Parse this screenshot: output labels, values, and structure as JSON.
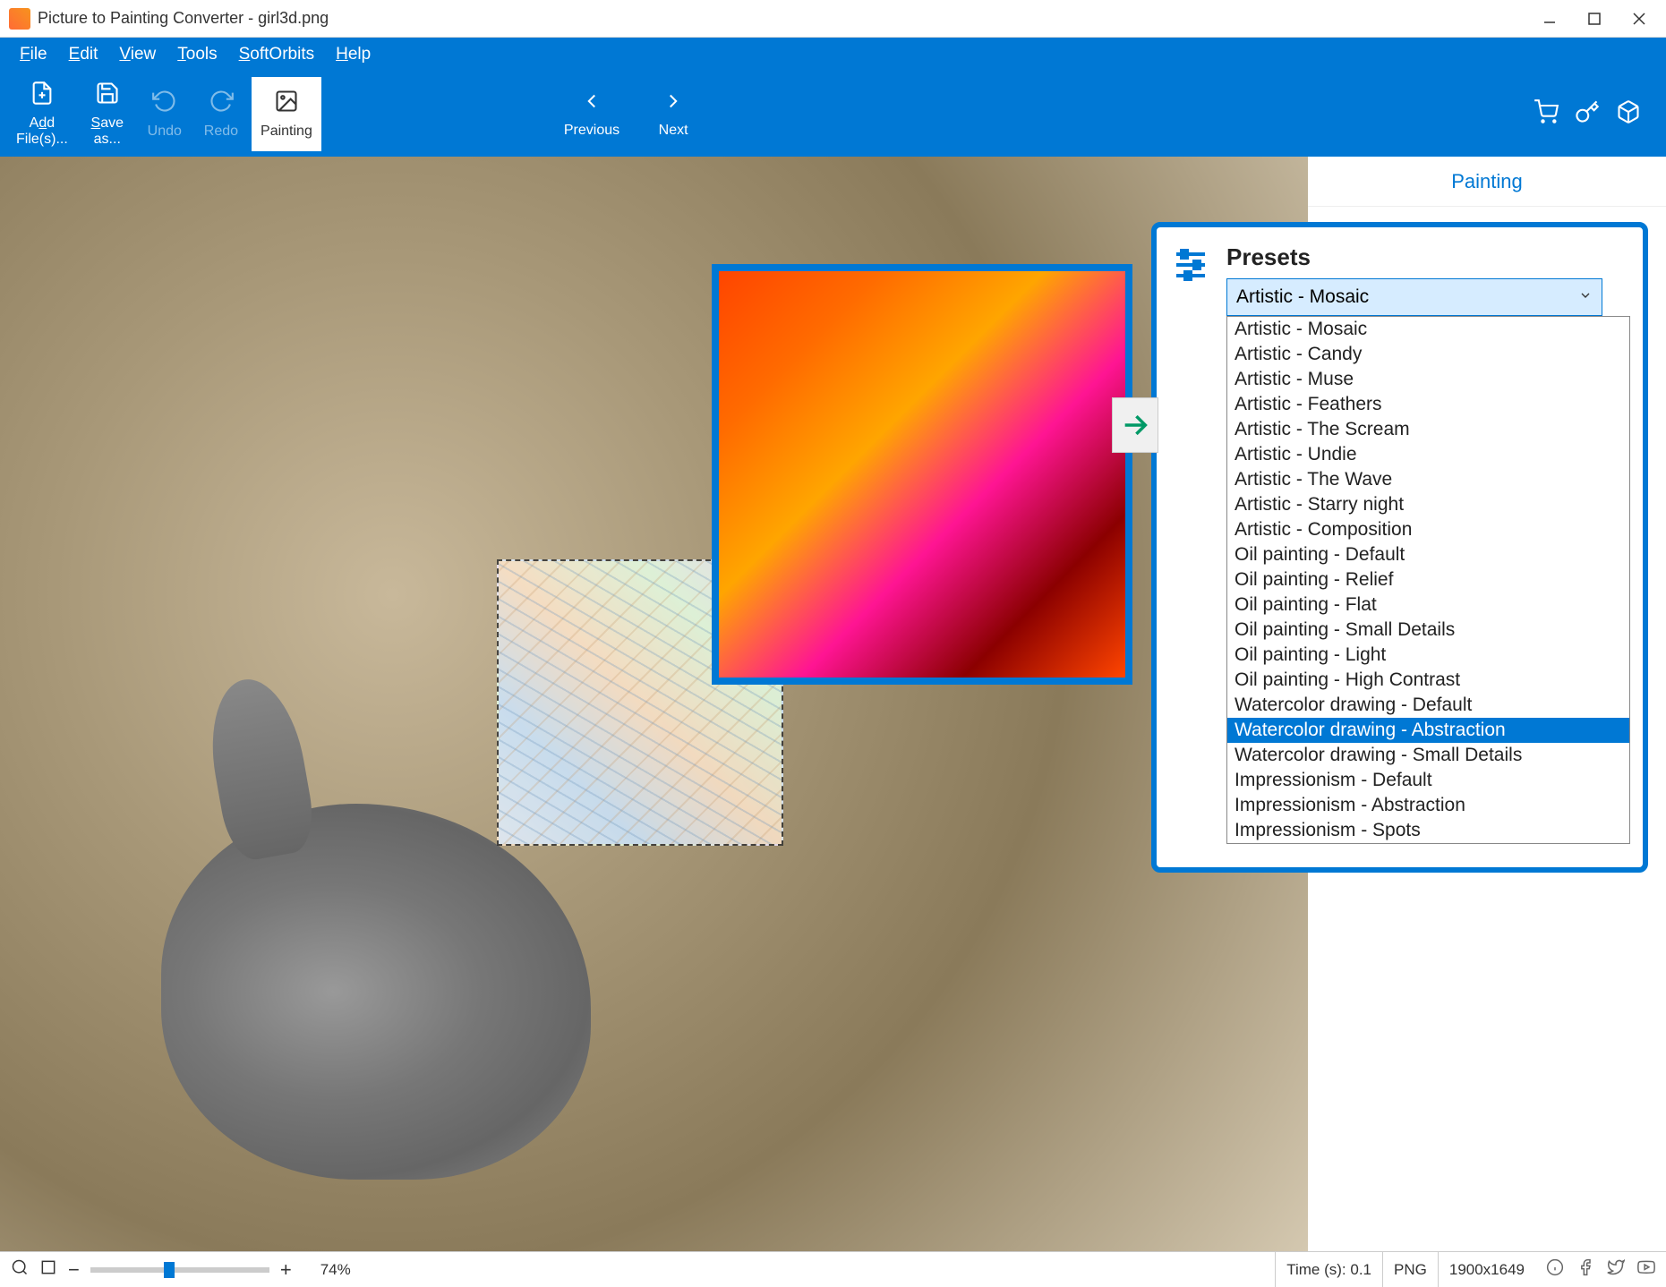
{
  "window": {
    "title": "Picture to Painting Converter - girl3d.png"
  },
  "menu": {
    "file": "File",
    "edit": "Edit",
    "view": "View",
    "tools": "Tools",
    "softorbits": "SoftOrbits",
    "help": "Help"
  },
  "toolbar": {
    "add_files": "Add\nFile(s)...",
    "save_as": "Save\nas...",
    "undo": "Undo",
    "redo": "Redo",
    "painting": "Painting",
    "previous": "Previous",
    "next": "Next"
  },
  "side": {
    "tab_painting": "Painting"
  },
  "presets": {
    "title": "Presets",
    "selected": "Artistic - Mosaic",
    "options": [
      "Artistic - Mosaic",
      "Artistic - Candy",
      "Artistic - Muse",
      "Artistic - Feathers",
      "Artistic - The Scream",
      "Artistic - Undie",
      "Artistic - The Wave",
      "Artistic - Starry night",
      "Artistic - Composition",
      "Oil painting - Default",
      "Oil painting - Relief",
      "Oil painting - Flat",
      "Oil painting - Small Details",
      "Oil painting - Light",
      "Oil painting - High Contrast",
      "Watercolor drawing - Default",
      "Watercolor drawing - Abstraction",
      "Watercolor drawing - Small Details",
      "Impressionism - Default",
      "Impressionism - Abstraction",
      "Impressionism - Spots"
    ],
    "highlighted_index": 16
  },
  "status": {
    "zoom_percent": "74%",
    "time": "Time (s): 0.1",
    "format": "PNG",
    "dimensions": "1900x1649",
    "zoom_minus": "−",
    "zoom_plus": "+"
  }
}
